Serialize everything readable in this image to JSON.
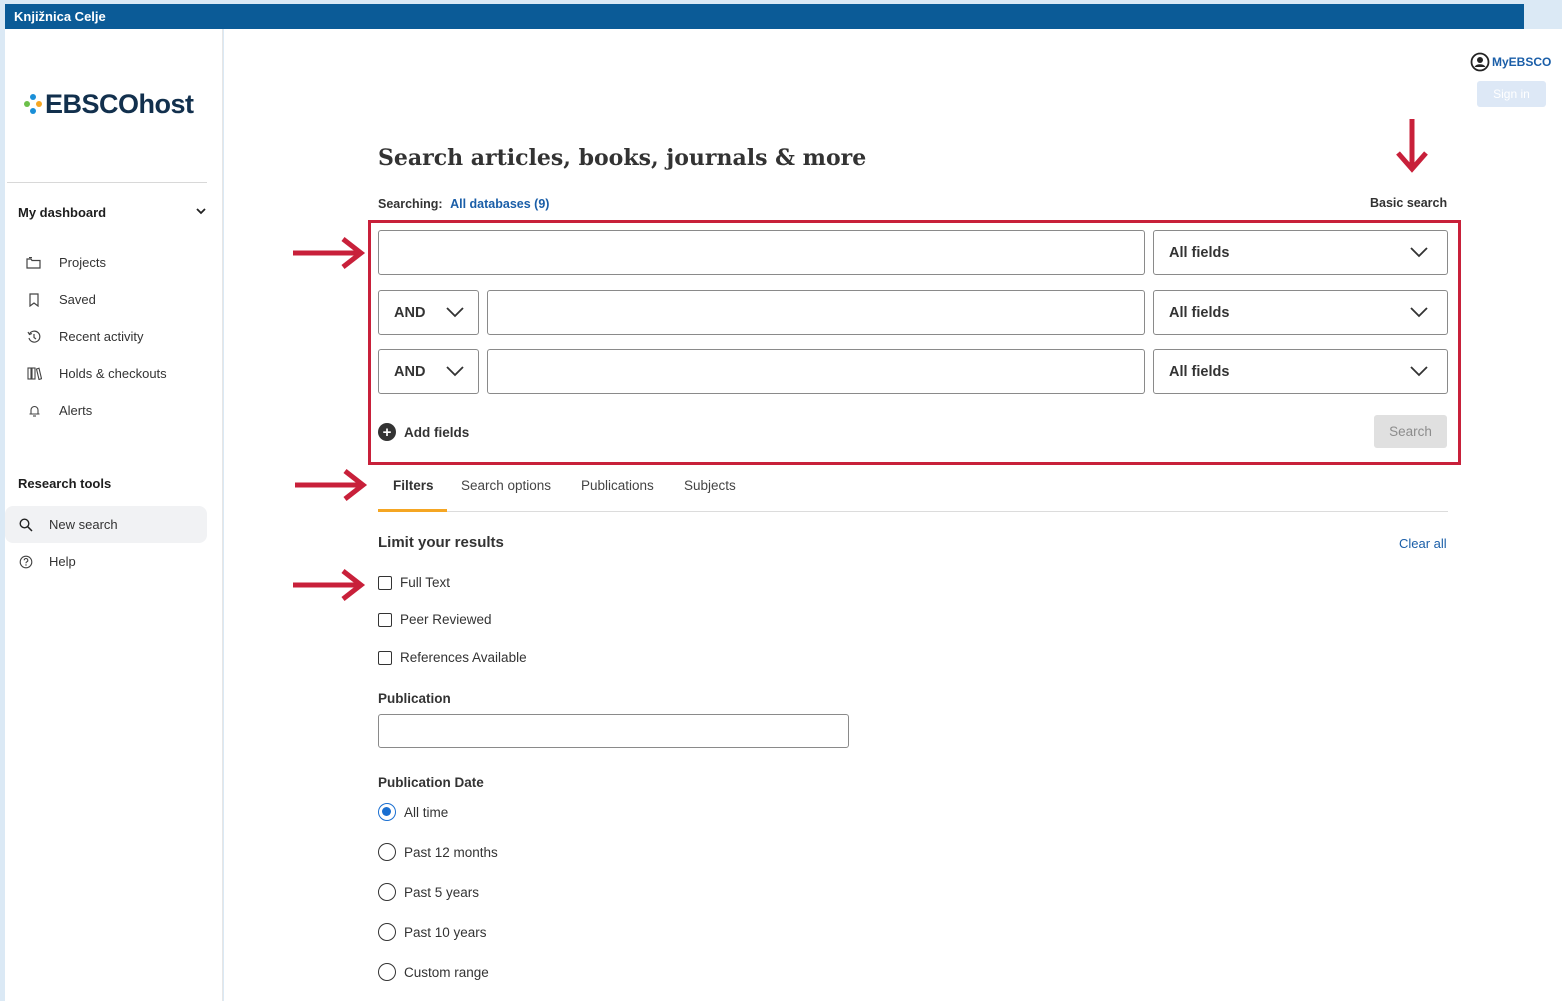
{
  "topbar": {
    "institution": "Knjižnica Celje"
  },
  "brand": {
    "logo_text": "EBSCOhost"
  },
  "sidebar": {
    "dashboard_heading": "My dashboard",
    "dashboard_items": [
      {
        "label": "Projects",
        "icon": "folder-icon"
      },
      {
        "label": "Saved",
        "icon": "bookmark-icon"
      },
      {
        "label": "Recent activity",
        "icon": "history-icon"
      },
      {
        "label": "Holds & checkouts",
        "icon": "books-icon"
      },
      {
        "label": "Alerts",
        "icon": "bell-icon"
      }
    ],
    "tools_heading": "Research tools",
    "tools_items": [
      {
        "label": "New search",
        "icon": "search-icon"
      },
      {
        "label": "Help",
        "icon": "help-icon"
      }
    ]
  },
  "account": {
    "myebsco_label": "MyEBSCO",
    "sign_in_label": "Sign in"
  },
  "search": {
    "title": "Search articles, books, journals & more",
    "searching_label": "Searching:",
    "databases_link": "All databases (9)",
    "basic_search_link": "Basic search",
    "rows": [
      {
        "operator": null,
        "value": "",
        "field": "All fields"
      },
      {
        "operator": "AND",
        "value": "",
        "field": "All fields"
      },
      {
        "operator": "AND",
        "value": "",
        "field": "All fields"
      }
    ],
    "add_fields_label": "Add fields",
    "search_button": "Search"
  },
  "tabs": [
    "Filters",
    "Search options",
    "Publications",
    "Subjects"
  ],
  "active_tab": "Filters",
  "filters": {
    "limit_heading": "Limit your results",
    "clear_all": "Clear all",
    "checkboxes": [
      {
        "label": "Full Text",
        "checked": false
      },
      {
        "label": "Peer Reviewed",
        "checked": false
      },
      {
        "label": "References Available",
        "checked": false
      }
    ],
    "publication_label": "Publication",
    "publication_value": "",
    "publication_date_label": "Publication Date",
    "date_options": [
      {
        "label": "All time",
        "selected": true
      },
      {
        "label": "Past 12 months",
        "selected": false
      },
      {
        "label": "Past 5 years",
        "selected": false
      },
      {
        "label": "Past 10 years",
        "selected": false
      },
      {
        "label": "Custom range",
        "selected": false
      }
    ]
  },
  "colors": {
    "topbar": "#0b5b97",
    "link": "#1a5ea8",
    "highlight_annotation": "#c8203a",
    "tab_underline": "#f5a623",
    "radio_selected": "#1a6fd1"
  }
}
